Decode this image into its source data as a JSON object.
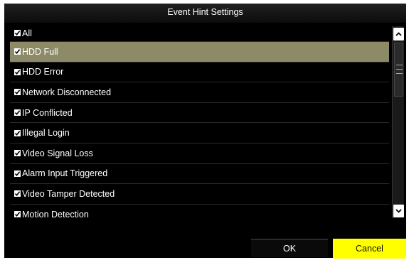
{
  "dialog": {
    "title": "Event Hint Settings"
  },
  "list": {
    "items": [
      {
        "label": "All",
        "checked": true
      },
      {
        "label": "HDD Full",
        "checked": true,
        "selected": true
      },
      {
        "label": "HDD Error",
        "checked": true
      },
      {
        "label": "Network Disconnected",
        "checked": true
      },
      {
        "label": "IP Conflicted",
        "checked": true
      },
      {
        "label": "Illegal Login",
        "checked": true
      },
      {
        "label": "Video Signal Loss",
        "checked": true
      },
      {
        "label": "Alarm Input Triggered",
        "checked": true
      },
      {
        "label": "Video Tamper Detected",
        "checked": true
      },
      {
        "label": "Motion Detection",
        "checked": true
      }
    ]
  },
  "footer": {
    "ok_label": "OK",
    "cancel_label": "Cancel"
  },
  "colors": {
    "selected_row": "#8c8a67",
    "cancel_button": "#ffff00",
    "background": "#000000"
  },
  "icons": {
    "checkbox": "checkmark-icon",
    "scroll_up": "chevron-up-icon",
    "scroll_down": "chevron-down-icon"
  }
}
